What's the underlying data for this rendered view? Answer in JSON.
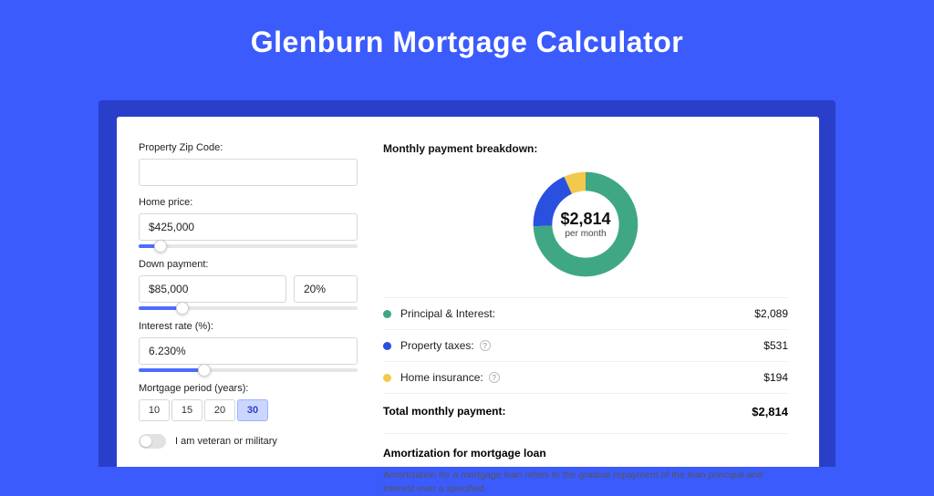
{
  "page": {
    "title": "Glenburn Mortgage Calculator"
  },
  "form": {
    "zip_label": "Property Zip Code:",
    "zip_value": "",
    "home_price_label": "Home price:",
    "home_price_value": "$425,000",
    "home_price_slider_pct": 10,
    "down_label": "Down payment:",
    "down_value": "$85,000",
    "down_pct_value": "20%",
    "down_slider_pct": 20,
    "rate_label": "Interest rate (%):",
    "rate_value": "6.230%",
    "rate_slider_pct": 30,
    "period_label": "Mortgage period (years):",
    "period_options": [
      "10",
      "15",
      "20",
      "30"
    ],
    "period_active_index": 3,
    "veteran_label": "I am veteran or military"
  },
  "breakdown": {
    "title": "Monthly payment breakdown:",
    "donut_amount": "$2,814",
    "donut_sub": "per month",
    "items": [
      {
        "label": "Principal & Interest:",
        "value": "$2,089",
        "color": "g",
        "help": false
      },
      {
        "label": "Property taxes:",
        "value": "$531",
        "color": "b",
        "help": true
      },
      {
        "label": "Home insurance:",
        "value": "$194",
        "color": "y",
        "help": true
      }
    ],
    "total_label": "Total monthly payment:",
    "total_value": "$2,814"
  },
  "amort": {
    "title": "Amortization for mortgage loan",
    "text": "Amortization for a mortgage loan refers to the gradual repayment of the loan principal and interest over a specified"
  },
  "chart_data": {
    "type": "pie",
    "title": "Monthly payment breakdown",
    "categories": [
      "Principal & Interest",
      "Property taxes",
      "Home insurance"
    ],
    "values": [
      2089,
      531,
      194
    ],
    "colors": [
      "#3fa784",
      "#2a50e0",
      "#f2c94c"
    ],
    "total": 2814,
    "total_label": "$2,814 per month"
  }
}
